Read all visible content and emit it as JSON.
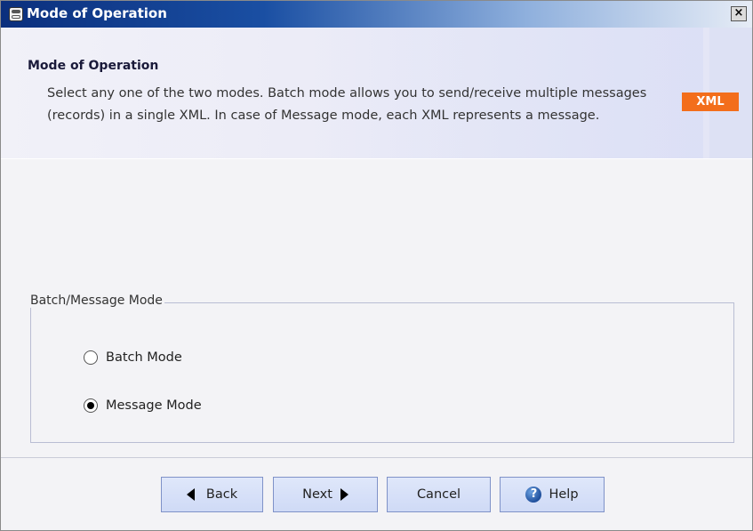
{
  "window": {
    "title": "Mode of Operation",
    "close_label": ""
  },
  "header": {
    "title": "Mode of Operation",
    "description": "Select any one of the two modes. Batch mode allows you to send/receive multiple messages (records) in a single XML. In case of Message mode, each XML represents a message.",
    "badge": "XML",
    "badge_color": "#f36e1b"
  },
  "group": {
    "legend": "Batch/Message Mode",
    "options": [
      {
        "label": "Batch Mode",
        "checked": false
      },
      {
        "label": "Message Mode",
        "checked": true
      }
    ],
    "selected": "Message Mode"
  },
  "footer": {
    "back_label": "Back",
    "next_label": "Next",
    "cancel_label": "Cancel",
    "help_label": "Help",
    "help_icon_glyph": "?"
  },
  "icons": {
    "app": "database-icon",
    "close": "close-icon",
    "back": "triangle-left-icon",
    "next": "triangle-right-icon",
    "help": "help-circle-icon"
  }
}
